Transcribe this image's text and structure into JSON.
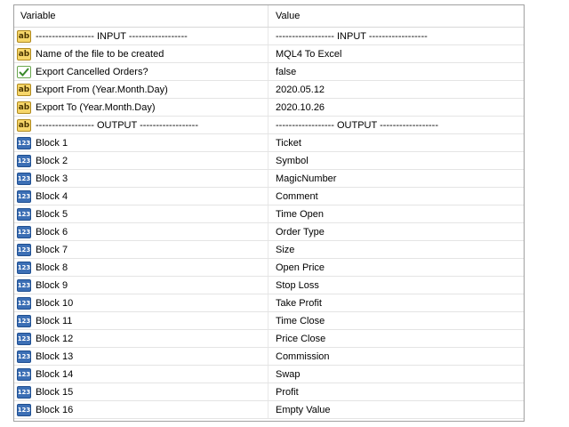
{
  "header": {
    "variable": "Variable",
    "value": "Value"
  },
  "icons": {
    "string": "ab",
    "number": "123",
    "boolean": "check-icon"
  },
  "colors": {
    "string_icon": "#f6d66a",
    "number_icon": "#3c6fb5",
    "boolean_icon": "#6aa84f"
  },
  "rows": [
    {
      "type": "string",
      "variable": "------------------ INPUT ------------------",
      "value": "------------------ INPUT ------------------"
    },
    {
      "type": "string",
      "variable": "Name of the file to be created",
      "value": "MQL4 To Excel"
    },
    {
      "type": "boolean",
      "variable": "Export Cancelled Orders?",
      "value": "false"
    },
    {
      "type": "string",
      "variable": "Export From (Year.Month.Day)",
      "value": "2020.05.12"
    },
    {
      "type": "string",
      "variable": "Export To (Year.Month.Day)",
      "value": "2020.10.26"
    },
    {
      "type": "string",
      "variable": "------------------ OUTPUT ------------------",
      "value": "------------------ OUTPUT ------------------"
    },
    {
      "type": "number",
      "variable": "Block 1",
      "value": "Ticket"
    },
    {
      "type": "number",
      "variable": "Block 2",
      "value": "Symbol"
    },
    {
      "type": "number",
      "variable": "Block 3",
      "value": "MagicNumber"
    },
    {
      "type": "number",
      "variable": "Block 4",
      "value": "Comment"
    },
    {
      "type": "number",
      "variable": "Block 5",
      "value": "Time Open"
    },
    {
      "type": "number",
      "variable": "Block 6",
      "value": "Order Type"
    },
    {
      "type": "number",
      "variable": "Block 7",
      "value": "Size"
    },
    {
      "type": "number",
      "variable": "Block 8",
      "value": "Open Price"
    },
    {
      "type": "number",
      "variable": "Block 9",
      "value": "Stop Loss"
    },
    {
      "type": "number",
      "variable": "Block 10",
      "value": "Take Profit"
    },
    {
      "type": "number",
      "variable": "Block 11",
      "value": "Time Close"
    },
    {
      "type": "number",
      "variable": "Block 12",
      "value": "Price Close"
    },
    {
      "type": "number",
      "variable": "Block 13",
      "value": "Commission"
    },
    {
      "type": "number",
      "variable": "Block 14",
      "value": "Swap"
    },
    {
      "type": "number",
      "variable": "Block 15",
      "value": "Profit"
    },
    {
      "type": "number",
      "variable": "Block 16",
      "value": "Empty Value"
    }
  ]
}
